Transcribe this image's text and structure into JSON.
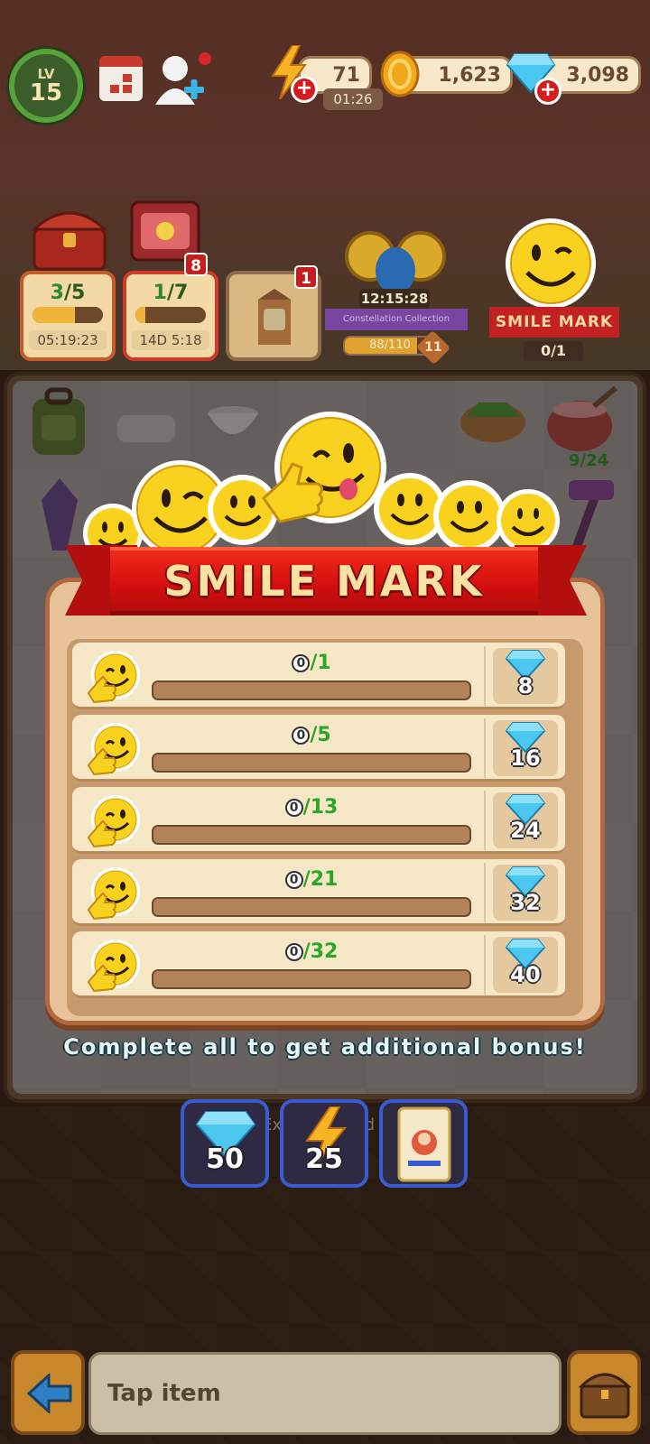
{
  "hud": {
    "level_label": "LV",
    "level": "15",
    "energy": "71",
    "energy_timer": "01:26",
    "coins": "1,623",
    "gems": "3,098"
  },
  "events": {
    "chest1": {
      "current": "3",
      "total": "/5",
      "time": "05:19:23"
    },
    "chest2": {
      "current": "1",
      "total": "/7",
      "time": "14D 5:18",
      "badge": "8"
    },
    "milk_badge": "1",
    "constellation": {
      "timer": "12:15:28",
      "title": "Constellation Collection",
      "progress_text": "88/110",
      "progress": 0.8,
      "level": "11"
    },
    "smile_mark": {
      "title": "SMILE MARK",
      "count": "0/1"
    }
  },
  "board": {
    "item_count_label": "9/24"
  },
  "modal": {
    "title": "SMILE MARK",
    "rows": [
      {
        "current": "0",
        "target": "/1",
        "progress": 0,
        "reward": "8"
      },
      {
        "current": "0",
        "target": "/5",
        "progress": 0,
        "reward": "16"
      },
      {
        "current": "0",
        "target": "/13",
        "progress": 0,
        "reward": "24"
      },
      {
        "current": "0",
        "target": "/21",
        "progress": 0,
        "reward": "32"
      },
      {
        "current": "0",
        "target": "/32",
        "progress": 0,
        "reward": "40"
      }
    ],
    "bonus_caption": "Complete all to get additional bonus!",
    "bonus": [
      {
        "icon": "gem-icon",
        "amount": "50"
      },
      {
        "icon": "energy-bolt-icon",
        "amount": "25"
      },
      {
        "icon": "joker-card-icon",
        "amount": ""
      }
    ]
  },
  "background_text": {
    "expand_board": "Expand board"
  },
  "bottom_bar": {
    "tap_item": "Tap item"
  },
  "colors": {
    "banner_red": "#d20e0e",
    "progress_green": "#2ca626",
    "panel": "#e8c39a",
    "bonus_border": "#3a5bd0"
  }
}
